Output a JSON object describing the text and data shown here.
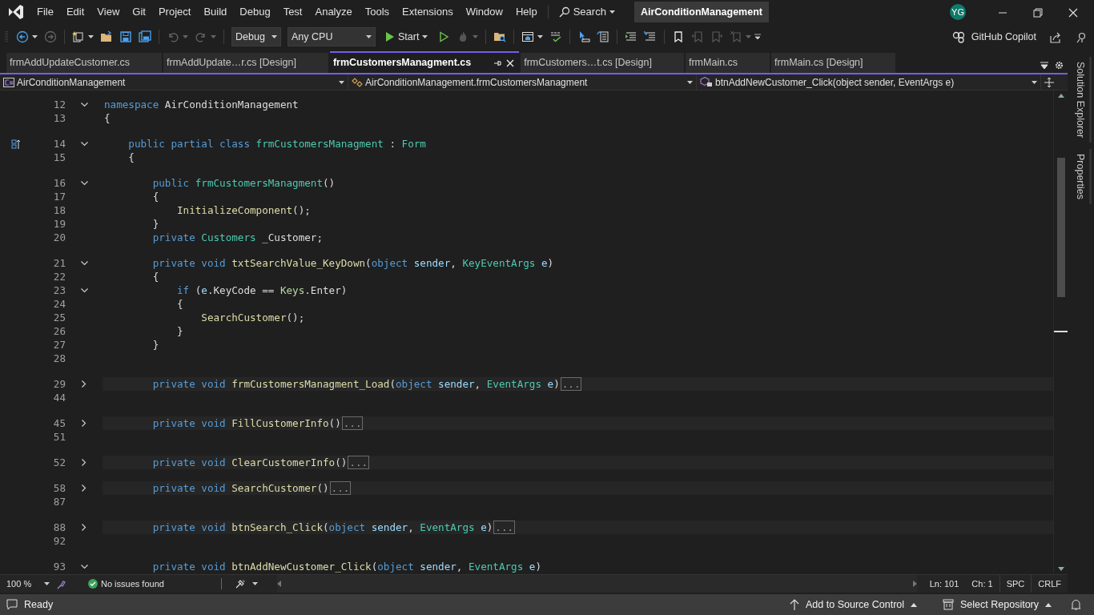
{
  "menu": {
    "items": [
      "File",
      "Edit",
      "View",
      "Git",
      "Project",
      "Build",
      "Debug",
      "Test",
      "Analyze",
      "Tools",
      "Extensions",
      "Window",
      "Help"
    ],
    "search_label": "Search",
    "solution_title": "AirConditionManagement",
    "user_initials": "YG"
  },
  "toolbar": {
    "groups": [
      [
        {
          "kind": "back",
          "disabled": false,
          "menu": true
        },
        {
          "kind": "forward",
          "disabled": true,
          "menu": false
        }
      ],
      [
        {
          "kind": "new-item",
          "disabled": false,
          "menu": true
        },
        {
          "kind": "open",
          "disabled": false,
          "menu": false
        },
        {
          "kind": "save",
          "disabled": false,
          "menu": false
        },
        {
          "kind": "save-all",
          "disabled": false,
          "menu": false
        }
      ],
      [
        {
          "kind": "undo",
          "disabled": true,
          "menu": true
        },
        {
          "kind": "redo",
          "disabled": true,
          "menu": true
        }
      ],
      [
        {
          "kind": "combo",
          "label": "Debug",
          "disabled": false,
          "menu": true
        },
        {
          "kind": "combo",
          "label": "Any CPU",
          "disabled": false,
          "menu": true
        },
        {
          "kind": "start",
          "label": "Start",
          "disabled": false,
          "menu": true
        },
        {
          "kind": "run-outline",
          "disabled": false,
          "menu": false
        },
        {
          "kind": "flame",
          "disabled": true,
          "menu": true
        }
      ],
      [
        {
          "kind": "folder-search",
          "disabled": false,
          "menu": false
        }
      ],
      [
        {
          "kind": "window",
          "disabled": false,
          "menu": true
        },
        {
          "kind": "spell",
          "disabled": false,
          "menu": false
        }
      ],
      [
        {
          "kind": "cursor",
          "disabled": false,
          "menu": false
        },
        {
          "kind": "document",
          "disabled": false,
          "menu": false
        }
      ],
      [
        {
          "kind": "indent",
          "disabled": false,
          "menu": false
        },
        {
          "kind": "outdent",
          "disabled": false,
          "menu": false
        }
      ],
      [
        {
          "kind": "bookmark",
          "disabled": false,
          "menu": false
        },
        {
          "kind": "bookmark-prev",
          "disabled": true,
          "menu": false
        },
        {
          "kind": "bookmark-next",
          "disabled": true,
          "menu": false
        },
        {
          "kind": "bookmark-clear",
          "disabled": true,
          "menu": true
        }
      ]
    ],
    "copilot_label": "GitHub Copilot"
  },
  "tabs": [
    {
      "label": "frmAddUpdateCustomer.cs",
      "selected": false
    },
    {
      "label": "frmAddUpdate…r.cs [Design]",
      "selected": false
    },
    {
      "label": "frmCustomersManagment.cs",
      "selected": true
    },
    {
      "label": "frmCustomers…t.cs [Design]",
      "selected": false
    },
    {
      "label": "frmMain.cs",
      "selected": false
    },
    {
      "label": "frmMain.cs [Design]",
      "selected": false
    }
  ],
  "nav": [
    {
      "kind": "project",
      "label": "AirConditionManagement"
    },
    {
      "kind": "class",
      "label": "AirConditionManagement.frmCustomersManagment"
    },
    {
      "kind": "member",
      "label": "btnAddNewCustomer_Click(object sender, EventArgs e)"
    }
  ],
  "lines": [
    {
      "number": "12",
      "expanded": true,
      "tokens": [
        {
          "kind": "kw",
          "text": "namespace"
        },
        {
          "kind": "plain",
          "text": " AirConditionManagement"
        }
      ]
    },
    {
      "number": "13",
      "tokens": [
        {
          "kind": "plain",
          "text": "{"
        }
      ]
    },
    {
      "number": "14",
      "spaced_above": true,
      "marker": true,
      "expanded": true,
      "tokens": [
        {
          "kind": "kw",
          "text": "    public partial class"
        },
        {
          "kind": "type",
          "text": " frmCustomersManagment"
        },
        {
          "kind": "plain",
          "text": " : "
        },
        {
          "kind": "type",
          "text": "Form"
        }
      ]
    },
    {
      "number": "15",
      "tokens": [
        {
          "kind": "plain",
          "text": "    {"
        }
      ]
    },
    {
      "number": "16",
      "spaced_above": true,
      "expanded": true,
      "tokens": [
        {
          "kind": "kw",
          "text": "        public"
        },
        {
          "kind": "type",
          "text": " frmCustomersManagment"
        },
        {
          "kind": "plain",
          "text": "()"
        }
      ]
    },
    {
      "number": "17",
      "tokens": [
        {
          "kind": "plain",
          "text": "        {"
        }
      ]
    },
    {
      "number": "18",
      "tokens": [
        {
          "kind": "fn",
          "text": "            InitializeComponent"
        },
        {
          "kind": "plain",
          "text": "();"
        }
      ]
    },
    {
      "number": "19",
      "tokens": [
        {
          "kind": "plain",
          "text": "        }"
        }
      ]
    },
    {
      "number": "20",
      "tokens": [
        {
          "kind": "kw",
          "text": "        private"
        },
        {
          "kind": "type",
          "text": " Customers"
        },
        {
          "kind": "plain",
          "text": " _Customer;"
        }
      ]
    },
    {
      "number": "21",
      "spaced_above": true,
      "expanded": true,
      "tokens": [
        {
          "kind": "kw",
          "text": "        private void"
        },
        {
          "kind": "fn",
          "text": " txtSearchValue_KeyDown"
        },
        {
          "kind": "plain",
          "text": "("
        },
        {
          "kind": "kw",
          "text": "object"
        },
        {
          "kind": "var",
          "text": " sender"
        },
        {
          "kind": "plain",
          "text": ", "
        },
        {
          "kind": "type",
          "text": "KeyEventArgs"
        },
        {
          "kind": "var",
          "text": " e"
        },
        {
          "kind": "plain",
          "text": ")"
        }
      ]
    },
    {
      "number": "22",
      "tokens": [
        {
          "kind": "plain",
          "text": "        {"
        }
      ]
    },
    {
      "number": "23",
      "expanded": true,
      "tokens": [
        {
          "kind": "kw",
          "text": "            if"
        },
        {
          "kind": "plain",
          "text": " ("
        },
        {
          "kind": "var",
          "text": "e"
        },
        {
          "kind": "plain",
          "text": ".KeyCode == "
        },
        {
          "kind": "enum",
          "text": "Keys"
        },
        {
          "kind": "plain",
          "text": ".Enter)"
        }
      ]
    },
    {
      "number": "24",
      "tokens": [
        {
          "kind": "plain",
          "text": "            {"
        }
      ]
    },
    {
      "number": "25",
      "tokens": [
        {
          "kind": "fn",
          "text": "                SearchCustomer"
        },
        {
          "kind": "plain",
          "text": "();"
        }
      ]
    },
    {
      "number": "26",
      "tokens": [
        {
          "kind": "plain",
          "text": "            }"
        }
      ]
    },
    {
      "number": "27",
      "tokens": [
        {
          "kind": "plain",
          "text": "        }"
        }
      ]
    },
    {
      "number": "28"
    },
    {
      "number": "29",
      "spaced_above": true,
      "expanded": false,
      "collapsed_text": "...",
      "tokens": [
        {
          "kind": "kw",
          "text": "        private void"
        },
        {
          "kind": "fn",
          "text": " frmCustomersManagment_Load"
        },
        {
          "kind": "plain",
          "text": "("
        },
        {
          "kind": "kw",
          "text": "object"
        },
        {
          "kind": "var",
          "text": " sender"
        },
        {
          "kind": "plain",
          "text": ", "
        },
        {
          "kind": "type",
          "text": "EventArgs"
        },
        {
          "kind": "var",
          "text": " e"
        },
        {
          "kind": "plain",
          "text": ")"
        }
      ]
    },
    {
      "number": "44"
    },
    {
      "number": "45",
      "spaced_above": true,
      "expanded": false,
      "collapsed_text": "...",
      "tokens": [
        {
          "kind": "kw",
          "text": "        private void"
        },
        {
          "kind": "fn",
          "text": " FillCustomerInfo"
        },
        {
          "kind": "plain",
          "text": "()"
        }
      ]
    },
    {
      "number": "51"
    },
    {
      "number": "52",
      "spaced_above": true,
      "expanded": false,
      "collapsed_text": "...",
      "tokens": [
        {
          "kind": "kw",
          "text": "        private void"
        },
        {
          "kind": "fn",
          "text": " ClearCustomerInfo"
        },
        {
          "kind": "plain",
          "text": "()"
        }
      ]
    },
    {
      "number": "58",
      "spaced_above": true,
      "expanded": false,
      "collapsed_text": "...",
      "tokens": [
        {
          "kind": "kw",
          "text": "        private void"
        },
        {
          "kind": "fn",
          "text": " SearchCustomer"
        },
        {
          "kind": "plain",
          "text": "()"
        }
      ]
    },
    {
      "number": "87"
    },
    {
      "number": "88",
      "spaced_above": true,
      "expanded": false,
      "collapsed_text": "...",
      "tokens": [
        {
          "kind": "kw",
          "text": "        private void"
        },
        {
          "kind": "fn",
          "text": " btnSearch_Click"
        },
        {
          "kind": "plain",
          "text": "("
        },
        {
          "kind": "kw",
          "text": "object"
        },
        {
          "kind": "var",
          "text": " sender"
        },
        {
          "kind": "plain",
          "text": ", "
        },
        {
          "kind": "type",
          "text": "EventArgs"
        },
        {
          "kind": "var",
          "text": " e"
        },
        {
          "kind": "plain",
          "text": ")"
        }
      ]
    },
    {
      "number": "92"
    },
    {
      "number": "93",
      "spaced_above": true,
      "expanded": true,
      "tokens": [
        {
          "kind": "kw",
          "text": "        private void"
        },
        {
          "kind": "fn",
          "text": " btnAddNewCustomer_Click"
        },
        {
          "kind": "plain",
          "text": "("
        },
        {
          "kind": "kw",
          "text": "object"
        },
        {
          "kind": "var",
          "text": " sender"
        },
        {
          "kind": "plain",
          "text": ", "
        },
        {
          "kind": "type",
          "text": "EventArgs"
        },
        {
          "kind": "var",
          "text": " e"
        },
        {
          "kind": "plain",
          "text": ")"
        }
      ]
    }
  ],
  "editor_status": {
    "zoom": "100 %",
    "issues": "No issues found",
    "line": "Ln: 101",
    "column": "Ch: 1",
    "whitespace": "SPC",
    "line_ending": "CRLF"
  },
  "side_tabs": [
    "Solution Explorer",
    "Properties"
  ],
  "status_bar": {
    "text": "Ready",
    "source_control": "Add to Source Control",
    "repository": "Select Repository"
  }
}
